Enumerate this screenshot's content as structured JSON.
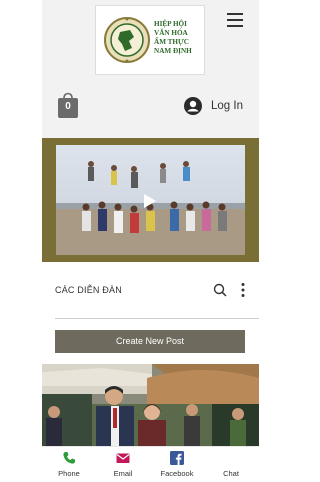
{
  "header": {
    "logo_lines": [
      "HIỆP HỘI",
      "VĂN HÓA",
      "ẨM THỰC",
      "NAM ĐỊNH"
    ],
    "cart_count": "0",
    "login_label": "Log In"
  },
  "forum": {
    "title": "CÁC DIỄN ĐÀN",
    "create_label": "Create New Post"
  },
  "bottom_bar": {
    "items": [
      {
        "label": "Phone",
        "icon": "phone-icon",
        "color": "#2e9e3a"
      },
      {
        "label": "Email",
        "icon": "email-icon",
        "color": "#c2185b"
      },
      {
        "label": "Facebook",
        "icon": "facebook-icon",
        "color": "#3b5998"
      },
      {
        "label": "Chat",
        "icon": "chat-icon",
        "color": "#333333"
      }
    ]
  },
  "colors": {
    "accent_olive": "#7a6e37",
    "button": "#6e6a5e",
    "header_bg": "#f2f2f2",
    "logo_green": "#2f6a2b"
  }
}
